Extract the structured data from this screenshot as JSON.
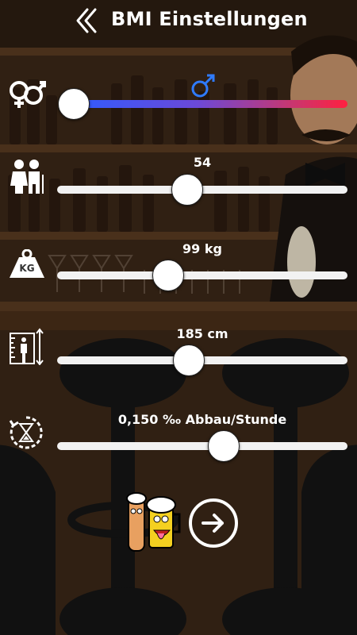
{
  "header": {
    "title": "BMI Einstellungen",
    "back_icon": "chevrons-left-icon"
  },
  "gender": {
    "icon": "gender-icon",
    "selected_icon": "male-symbol-icon",
    "value": 0.0,
    "gradient": [
      "#2f5cff",
      "#ff2040"
    ]
  },
  "age": {
    "icon": "elderly-couple-icon",
    "label": "54",
    "value": 54
  },
  "weight": {
    "icon": "weight-kg-icon",
    "icon_text": "KG",
    "label": "99 kg",
    "value": 99
  },
  "height": {
    "icon": "height-measure-icon",
    "label": "185 cm",
    "value": 185
  },
  "degradation": {
    "icon": "hourglass-timer-icon",
    "label": "0,150 ‰ Abbau/Stunde",
    "value": 0.15
  },
  "footer": {
    "mascot_icon": "beer-mascots-icon",
    "next_icon": "arrow-right-icon"
  },
  "colors": {
    "accent_blue": "#2f7bff",
    "background": "#3a2616"
  }
}
